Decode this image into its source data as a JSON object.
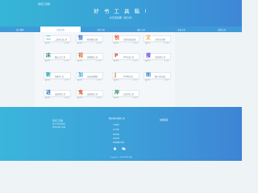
{
  "header": {
    "brand": "贤哥工具箱",
    "title": "好 书 工 具 箱 !",
    "subtitle": "好东西就要一起分享!"
  },
  "tabs": [
    {
      "label": "热门推荐"
    },
    {
      "label": "生活工具"
    },
    {
      "label": "文本工具"
    },
    {
      "label": "图片工具"
    },
    {
      "label": "开发工具"
    },
    {
      "label": "其他工具"
    }
  ],
  "cards": [
    {
      "glyph": "二",
      "color": "#37b5d6",
      "name": "二维码生成工具",
      "meta": "● 网址",
      "stat": "◷ 访问"
    },
    {
      "glyph": "整",
      "color": "#3d7fd1",
      "name": "整句翻译在线",
      "meta": "● 网址",
      "stat": "◷ 访问"
    },
    {
      "glyph": "悦",
      "color": "#e85a2f",
      "name": "在线悦读阅读器",
      "meta": "● 网址",
      "stat": "◷ 访问"
    },
    {
      "glyph": "文",
      "color": "#f0a32c",
      "name": "文件格式转换",
      "meta": "● 网址",
      "stat": "◷ 访问"
    },
    {
      "glyph": "床",
      "color": "#2e8a6a",
      "name": "图床上传工具",
      "meta": "● 网址",
      "stat": "◷ 访问"
    },
    {
      "glyph": "视",
      "color": "#d36a2a",
      "name": "视频解析工具",
      "meta": "● 网址",
      "stat": "◷ 访问"
    },
    {
      "glyph": "P",
      "color": "#d6402a",
      "name": "PDF在线工具",
      "meta": "● 网址",
      "stat": "◷ 访问"
    },
    {
      "glyph": "搜",
      "color": "#6c4bd6",
      "name": "在线搜索工具",
      "meta": "● 网址",
      "stat": "◷ 访问"
    },
    {
      "glyph": "新",
      "color": "#1fa3b5",
      "name": "新媒体工具",
      "meta": "● 网址",
      "stat": "◷ 访问"
    },
    {
      "glyph": "加",
      "color": "#2fa8e0",
      "name": "在线加密解密",
      "meta": "● 网址",
      "stat": "◷ 访问"
    },
    {
      "glyph": "J",
      "color": "#e0801f",
      "name": "JSON格式化",
      "meta": "● 网址",
      "stat": "◷ 访问"
    },
    {
      "glyph": "图",
      "color": "#3b8fd8",
      "name": "图片在线压缩",
      "meta": "● 网址",
      "stat": "◷ 访问"
    },
    {
      "glyph": "进",
      "color": "#2b78c7",
      "name": "进制转换工具",
      "meta": "● 网址",
      "stat": "◷ 访问"
    },
    {
      "glyph": "鬼",
      "color": "#e05a34",
      "name": "鬼畜视频工具",
      "meta": "● 网址",
      "stat": "◷ 访问"
    },
    {
      "glyph": "岸",
      "color": "#2a8c6b",
      "name": "在线岸线工具",
      "meta": "● 网址",
      "stat": "◷ 访问"
    }
  ],
  "footer": {
    "brand": "贤哥工具箱",
    "lines": [
      "热门工具在线使用",
      "免费好用的工具箱"
    ],
    "links_head": "网站导航与推荐工具",
    "links": [
      "工具首页",
      "关于我们",
      "意见反馈",
      "免责声明",
      "网站地图与导航"
    ],
    "right_text": "友情链接",
    "copyright": "Copyright © 2024 贤哥工具箱"
  },
  "icons": {
    "social_1": "qq-icon",
    "social_2": "wechat-icon"
  },
  "colors": {
    "accent": "#3a9fd8",
    "active_tab_text": "#3a8fd0"
  }
}
